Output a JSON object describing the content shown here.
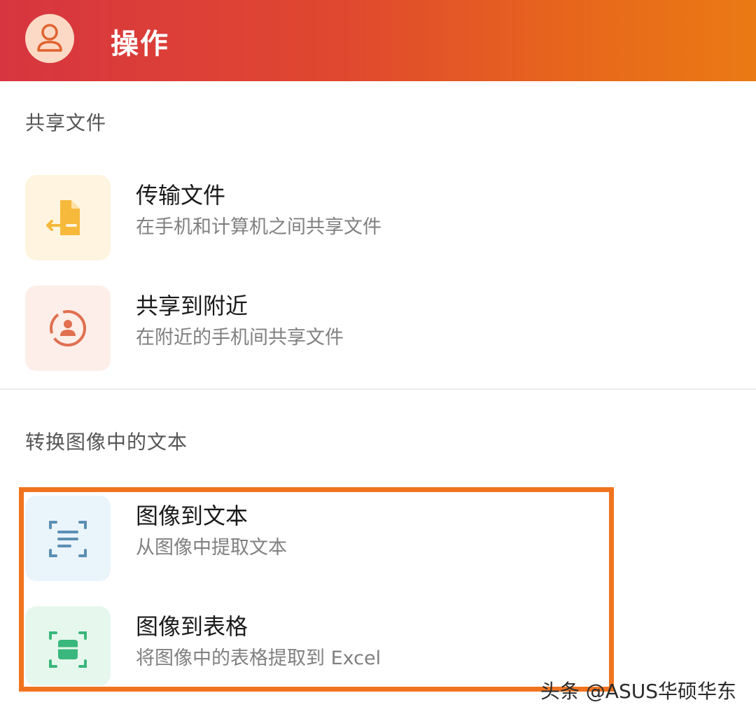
{
  "header": {
    "title": "操作",
    "avatar_icon": "user-avatar-icon"
  },
  "sections": [
    {
      "title": "共享文件",
      "items": [
        {
          "title": "传输文件",
          "subtitle": "在手机和计算机之间共享文件",
          "icon": "file-transfer-icon",
          "tile_color": "#fff4df",
          "icon_color": "#f6b93b"
        },
        {
          "title": "共享到附近",
          "subtitle": "在附近的手机间共享文件",
          "icon": "nearby-share-icon",
          "tile_color": "#fdeee9",
          "icon_color": "#e07050"
        }
      ]
    },
    {
      "title": "转换图像中的文本",
      "items": [
        {
          "title": "图像到文本",
          "subtitle": "从图像中提取文本",
          "icon": "scan-text-icon",
          "tile_color": "#eaf4fb",
          "icon_color": "#5b8fb3"
        },
        {
          "title": "图像到表格",
          "subtitle": "将图像中的表格提取到 Excel",
          "icon": "scan-table-icon",
          "tile_color": "#e6f8ee",
          "icon_color": "#3ab77c"
        }
      ]
    }
  ],
  "highlight_color": "#f0741f",
  "watermark": "头条 @ASUS华硕华东"
}
